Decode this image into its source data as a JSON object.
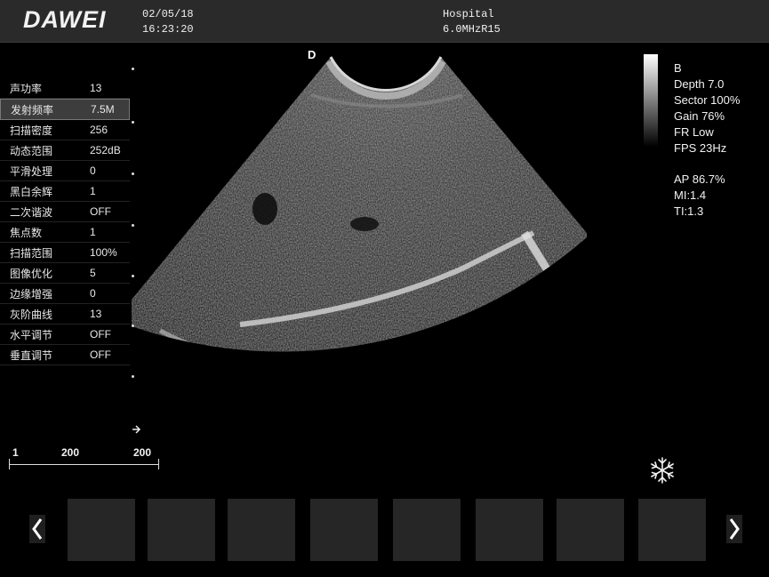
{
  "header": {
    "brand": "DAWEI",
    "date": "02/05/18",
    "time": "16:23:20",
    "hospital": "Hospital",
    "probe": "6.0MHzR15"
  },
  "params": [
    {
      "label": "声功率",
      "value": "13"
    },
    {
      "label": "发射频率",
      "value": "7.5M",
      "selected": true
    },
    {
      "label": "扫描密度",
      "value": "256"
    },
    {
      "label": "动态范围",
      "value": "252dB"
    },
    {
      "label": "平滑处理",
      "value": "0"
    },
    {
      "label": "黑白余辉",
      "value": "1"
    },
    {
      "label": "二次谐波",
      "value": "OFF"
    },
    {
      "label": "焦点数",
      "value": "1"
    },
    {
      "label": "扫描范围",
      "value": "100%"
    },
    {
      "label": "图像优化",
      "value": "5"
    },
    {
      "label": "边缘增强",
      "value": "0"
    },
    {
      "label": "灰阶曲线",
      "value": "13"
    },
    {
      "label": "水平调节",
      "value": "OFF"
    },
    {
      "label": "垂直调节",
      "value": "OFF"
    }
  ],
  "orientation_marker": "D",
  "info": {
    "mode": "B",
    "depth": "Depth 7.0",
    "sector": "Sector 100%",
    "gain": "Gain 76%",
    "frame_rate": "FR Low",
    "fps": "FPS 23Hz",
    "ap": "AP 86.7%",
    "mi": "MI:1.4",
    "ti": "TI:1.3"
  },
  "scale": {
    "left": "1",
    "mid": "200",
    "right": "200"
  },
  "icons": {
    "freeze": "snowflake-icon",
    "prev": "chevron-left-icon",
    "next": "chevron-right-icon",
    "cursor": "arrow-cursor-icon"
  },
  "thumbnail_count": 8
}
